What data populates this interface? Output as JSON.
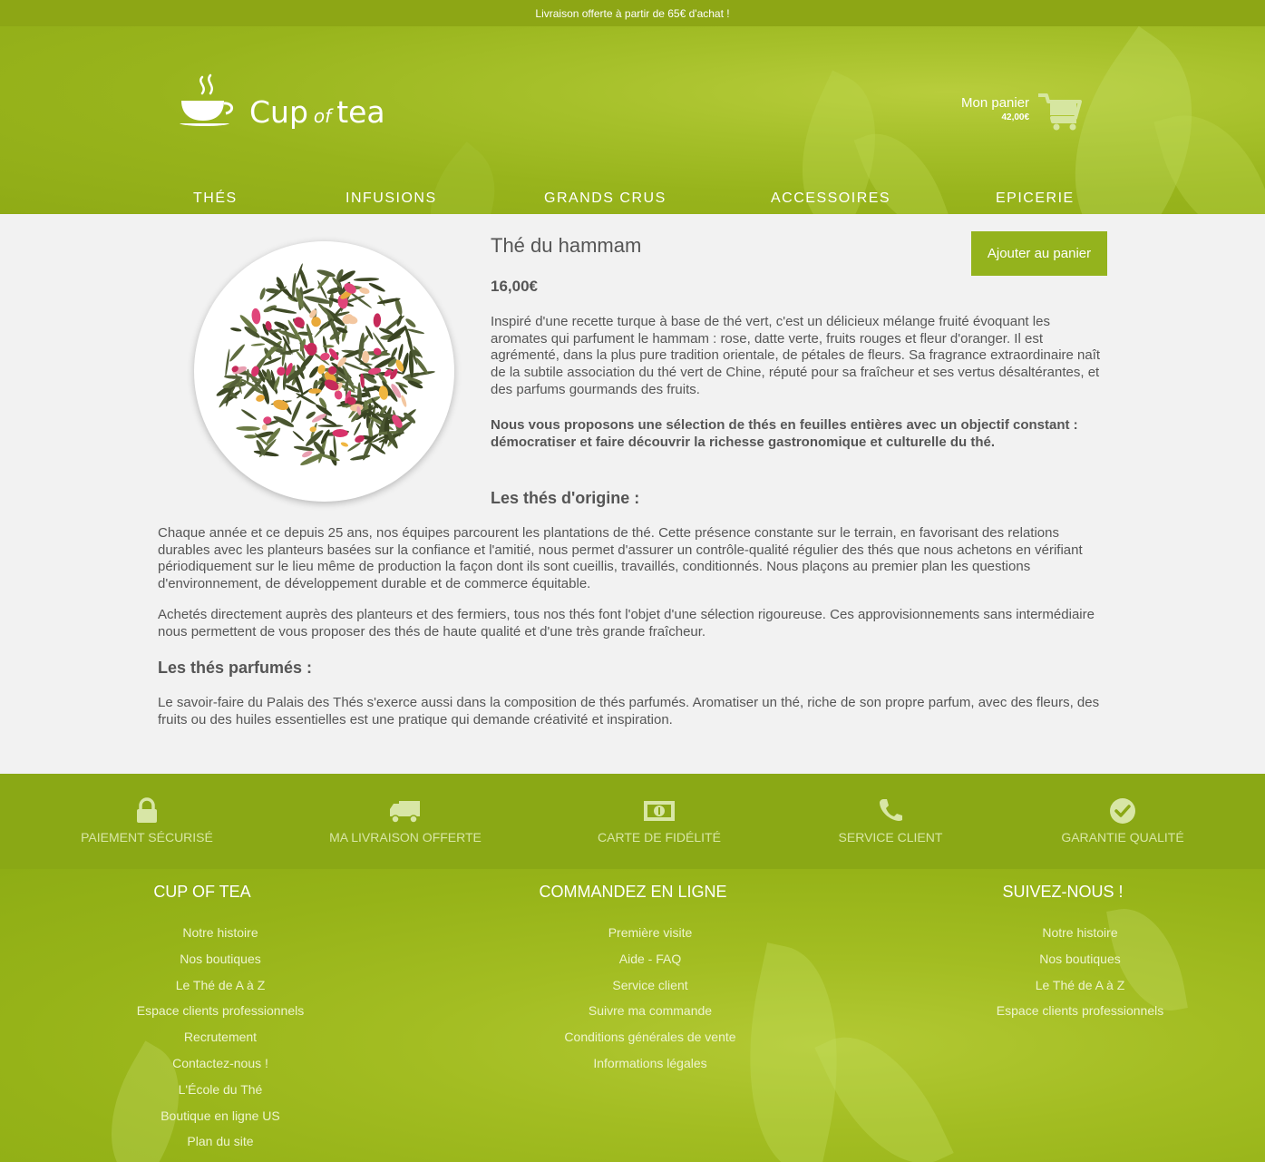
{
  "topbar": {
    "text": "Livraison offerte à partir de 65€ d'achat !"
  },
  "logo": {
    "cup": "Cup",
    "of": "of",
    "tea": "tea"
  },
  "cart": {
    "label": "Mon panier",
    "amount": "42,00€",
    "icon": "shopping-cart-icon"
  },
  "nav": {
    "items": [
      "THÉS",
      "INFUSIONS",
      "GRANDS CRUS",
      "ACCESSOIRES",
      "EPICERIE"
    ]
  },
  "product": {
    "title": "Thé du hammam",
    "price": "16,00€",
    "add_to_cart": "Ajouter au panier",
    "description": "Inspiré d'une recette turque à base de thé vert, c'est un délicieux mélange fruité évoquant les aromates qui parfument le hammam : rose, datte verte, fruits rouges et fleur d'oranger. Il est agrémenté, dans la plus pure tradition orientale, de pétales de fleurs. Sa fragrance extraordinaire naît de la subtile association du thé vert de Chine, réputé pour sa fraîcheur et ses vertus désaltérantes, et des parfums gourmands des fruits.",
    "highlight": "Nous vous proposons une sélection de thés en feuilles entières avec un objectif constant : démocratiser et faire découvrir la richesse gastronomique et culturelle du thé.",
    "origin_heading": "Les thés d'origine :",
    "origin_p1": "Chaque année et ce depuis 25 ans, nos équipes parcourent les plantations de thé. Cette présence constante sur le terrain, en favorisant des relations durables avec les planteurs basées sur la confiance et l'amitié, nous permet d'assurer un contrôle-qualité régulier des thés que nous achetons en vérifiant périodiquement sur le lieu même de production la façon dont ils sont cueillis, travaillés, conditionnés. Nous plaçons au premier plan les questions d'environnement, de développement durable et de commerce équitable.",
    "origin_p2": "Achetés directement auprès des planteurs et des fermiers, tous nos thés font l'objet d'une sélection rigoureuse. Ces approvisionnements sans intermédiaire nous permettent de vous proposer des thés de haute qualité et d'une très grande fraîcheur.",
    "flavored_heading": "Les thés parfumés :",
    "flavored_p": "Le savoir-faire du Palais des Thés s'exerce aussi dans la composition de thés parfumés. Aromatiser un thé, riche de son propre parfum, avec des fleurs, des fruits ou des huiles essentielles est une pratique qui demande créativité et inspiration."
  },
  "features": [
    {
      "label": "PAIEMENT SÉCURISÉ",
      "icon": "lock-icon"
    },
    {
      "label": "MA LIVRAISON OFFERTE",
      "icon": "truck-icon"
    },
    {
      "label": "CARTE DE FIDÉLITÉ",
      "icon": "money-icon"
    },
    {
      "label": "SERVICE CLIENT",
      "icon": "phone-icon"
    },
    {
      "label": "GARANTIE QUALITÉ",
      "icon": "check-circle-icon"
    }
  ],
  "footer": {
    "col1": {
      "heading": "CUP OF TEA",
      "links": [
        "Notre histoire",
        "Nos boutiques",
        "Le Thé de A à Z",
        "Espace clients professionnels",
        "Recrutement",
        "Contactez-nous !",
        "L'École du Thé",
        "Boutique en ligne US",
        "Plan du site"
      ]
    },
    "col2": {
      "heading": "COMMANDEZ EN LIGNE",
      "links": [
        "Première visite",
        "Aide - FAQ",
        "Service client",
        "Suivre ma commande",
        "Conditions générales de vente",
        "Informations légales"
      ]
    },
    "col3": {
      "heading": "SUIVEZ-NOUS !",
      "links": [
        "Notre histoire",
        "Nos boutiques",
        "Le Thé de A à Z",
        "Espace clients professionnels"
      ]
    }
  }
}
